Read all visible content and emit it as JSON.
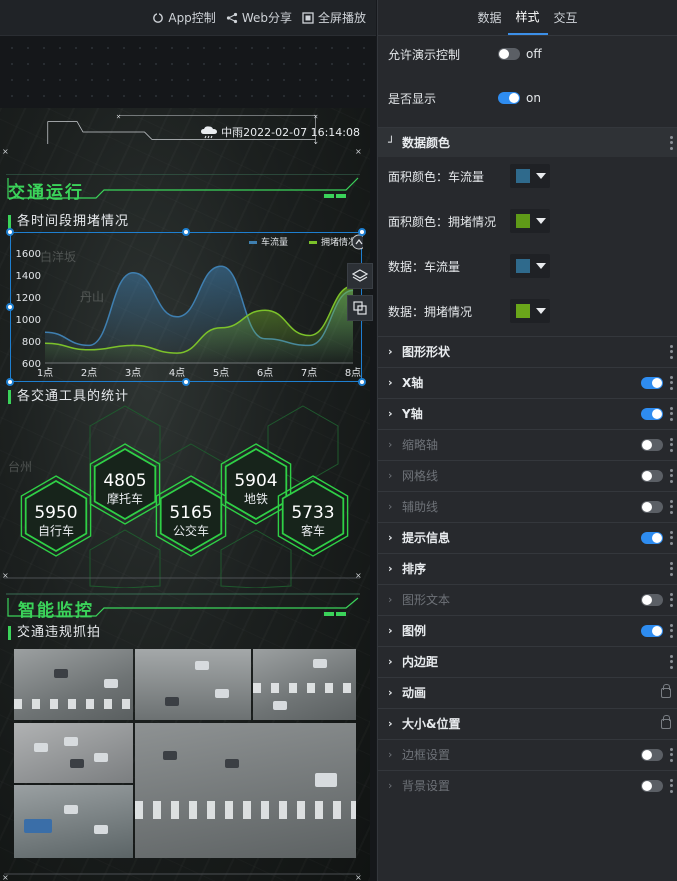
{
  "toolbar": {
    "app_control": "App控制",
    "web_share": "Web分享",
    "fullscreen": "全屏播放"
  },
  "screen": {
    "weather": "中雨2022-02-07 16:14:08",
    "map_labels": [
      "白洋坂",
      "丹山",
      "台州"
    ],
    "section1_title": "交通运行",
    "sub1_title": "各时间段拥堵情况",
    "sub2_title": "各交通工具的统计",
    "section2_title": "智能监控",
    "sub3_title": "交通违规抓拍",
    "hexes": [
      {
        "value": "5950",
        "label": "自行车"
      },
      {
        "value": "4805",
        "label": "摩托车"
      },
      {
        "value": "5165",
        "label": "公交车"
      },
      {
        "value": "5904",
        "label": "地铁"
      },
      {
        "value": "5733",
        "label": "客车"
      }
    ]
  },
  "chart_data": {
    "type": "area",
    "categories": [
      "1点",
      "2点",
      "3点",
      "4点",
      "5点",
      "6点",
      "7点",
      "8点"
    ],
    "ylim": [
      600,
      1600
    ],
    "yticks": [
      "1600",
      "1400",
      "1200",
      "1000",
      "800",
      "600"
    ],
    "series": [
      {
        "name": "车流量",
        "color": "#3f7fb0",
        "values": [
          880,
          760,
          1420,
          1020,
          1480,
          820,
          760,
          1260
        ]
      },
      {
        "name": "拥堵情况",
        "color": "#7cc22a",
        "values": [
          780,
          720,
          760,
          690,
          920,
          1080,
          850,
          1300
        ]
      }
    ],
    "legend_position": "top-right"
  },
  "panel": {
    "tabs": [
      "数据",
      "样式",
      "交互"
    ],
    "active_tab": "样式",
    "allow_control_label": "允许演示控制",
    "allow_control_value": "off",
    "display_label": "是否显示",
    "display_value": "on",
    "data_color_group": "数据颜色",
    "color_rows": [
      {
        "label": "面积颜色：车流量",
        "color": "#2f6a8c"
      },
      {
        "label": "面积颜色：拥堵情况",
        "color": "#5f9a18"
      },
      {
        "label": "数据：车流量",
        "color": "#2f6a8c"
      },
      {
        "label": "数据：拥堵情况",
        "color": "#6aa61a"
      }
    ],
    "groups": [
      {
        "label": "图形形状",
        "dim": false,
        "toggle": null,
        "lock": false
      },
      {
        "label": "X轴",
        "dim": false,
        "toggle": "on",
        "lock": false
      },
      {
        "label": "Y轴",
        "dim": false,
        "toggle": "on",
        "lock": false
      },
      {
        "label": "缩略轴",
        "dim": true,
        "toggle": "off",
        "lock": false
      },
      {
        "label": "网格线",
        "dim": true,
        "toggle": "off",
        "lock": false
      },
      {
        "label": "辅助线",
        "dim": true,
        "toggle": "off",
        "lock": false
      },
      {
        "label": "提示信息",
        "dim": false,
        "toggle": "on",
        "lock": false
      },
      {
        "label": "排序",
        "dim": false,
        "toggle": null,
        "lock": false
      },
      {
        "label": "图形文本",
        "dim": true,
        "toggle": "off",
        "lock": false
      },
      {
        "label": "图例",
        "dim": false,
        "toggle": "on",
        "lock": false
      },
      {
        "label": "内边距",
        "dim": false,
        "toggle": null,
        "lock": false
      },
      {
        "label": "动画",
        "dim": false,
        "toggle": null,
        "lock": true
      },
      {
        "label": "大小&位置",
        "dim": false,
        "toggle": null,
        "lock": true
      },
      {
        "label": "边框设置",
        "dim": true,
        "toggle": "off",
        "lock": false
      },
      {
        "label": "背景设置",
        "dim": true,
        "toggle": "off",
        "lock": false
      }
    ]
  }
}
